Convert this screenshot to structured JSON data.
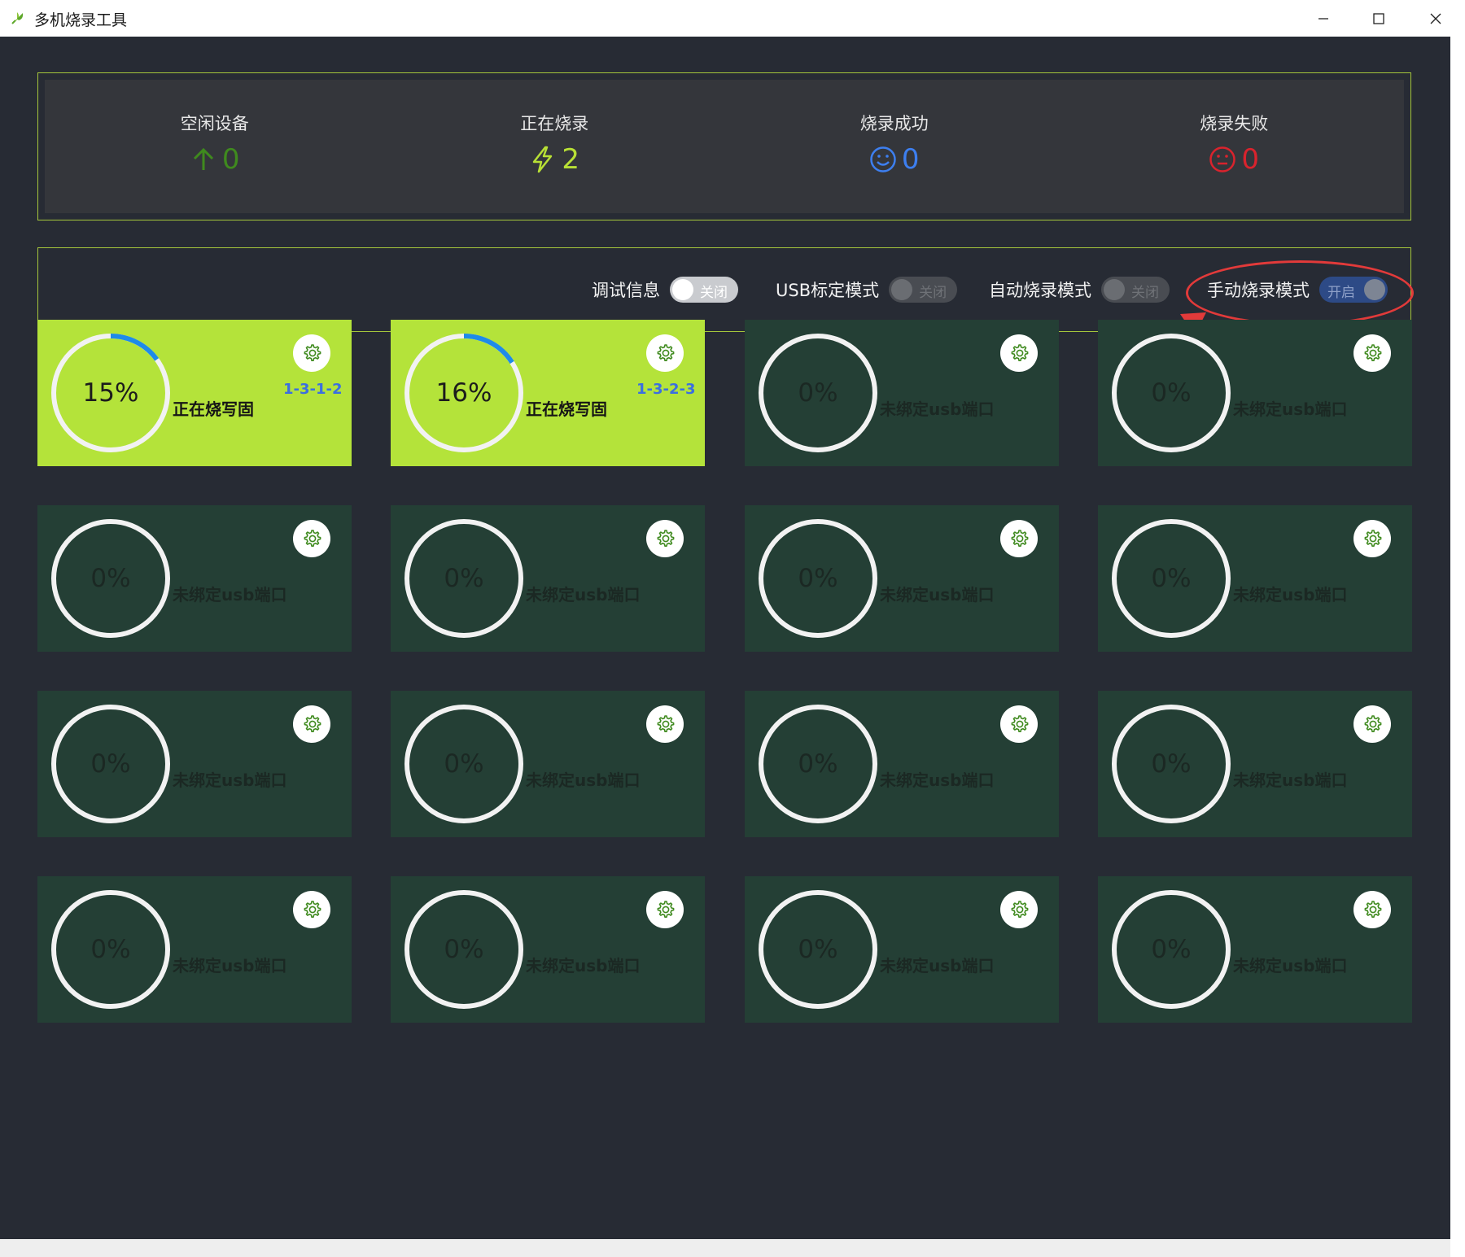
{
  "window": {
    "title": "多机烧录工具"
  },
  "colors": {
    "accent_green": "#a5c63b",
    "active_card": "#b4e33a",
    "idle_card": "#243f35",
    "progress_blue": "#1e8be8",
    "port_blue": "#3b6fe0"
  },
  "stats": [
    {
      "label": "空闲设备",
      "value": "0",
      "icon": "arrow-up-icon",
      "color": "#3f8a1e"
    },
    {
      "label": "正在烧录",
      "value": "2",
      "icon": "lightning-icon",
      "color": "#b8e035"
    },
    {
      "label": "烧录成功",
      "value": "0",
      "icon": "smile-icon",
      "color": "#3d7ff0"
    },
    {
      "label": "烧录失败",
      "value": "0",
      "icon": "neutral-face-icon",
      "color": "#d9232d"
    }
  ],
  "toggles": [
    {
      "label": "调试信息",
      "state": "关闭",
      "on": false,
      "enabled": true
    },
    {
      "label": "USB标定模式",
      "state": "关闭",
      "on": false,
      "enabled": false
    },
    {
      "label": "自动烧录模式",
      "state": "关闭",
      "on": false,
      "enabled": false
    },
    {
      "label": "手动烧录模式",
      "state": "开启",
      "on": true,
      "enabled": true
    }
  ],
  "devices": [
    {
      "progress": 15,
      "percent_text": "15%",
      "status": "正在烧写固",
      "port": "1-3-1-2",
      "active": true
    },
    {
      "progress": 16,
      "percent_text": "16%",
      "status": "正在烧写固",
      "port": "1-3-2-3",
      "active": true
    },
    {
      "progress": 0,
      "percent_text": "0%",
      "status": "未绑定usb端口",
      "port": "",
      "active": false
    },
    {
      "progress": 0,
      "percent_text": "0%",
      "status": "未绑定usb端口",
      "port": "",
      "active": false
    },
    {
      "progress": 0,
      "percent_text": "0%",
      "status": "未绑定usb端口",
      "port": "",
      "active": false
    },
    {
      "progress": 0,
      "percent_text": "0%",
      "status": "未绑定usb端口",
      "port": "",
      "active": false
    },
    {
      "progress": 0,
      "percent_text": "0%",
      "status": "未绑定usb端口",
      "port": "",
      "active": false
    },
    {
      "progress": 0,
      "percent_text": "0%",
      "status": "未绑定usb端口",
      "port": "",
      "active": false
    },
    {
      "progress": 0,
      "percent_text": "0%",
      "status": "未绑定usb端口",
      "port": "",
      "active": false
    },
    {
      "progress": 0,
      "percent_text": "0%",
      "status": "未绑定usb端口",
      "port": "",
      "active": false
    },
    {
      "progress": 0,
      "percent_text": "0%",
      "status": "未绑定usb端口",
      "port": "",
      "active": false
    },
    {
      "progress": 0,
      "percent_text": "0%",
      "status": "未绑定usb端口",
      "port": "",
      "active": false
    },
    {
      "progress": 0,
      "percent_text": "0%",
      "status": "未绑定usb端口",
      "port": "",
      "active": false
    },
    {
      "progress": 0,
      "percent_text": "0%",
      "status": "未绑定usb端口",
      "port": "",
      "active": false
    },
    {
      "progress": 0,
      "percent_text": "0%",
      "status": "未绑定usb端口",
      "port": "",
      "active": false
    },
    {
      "progress": 0,
      "percent_text": "0%",
      "status": "未绑定usb端口",
      "port": "",
      "active": false
    }
  ]
}
